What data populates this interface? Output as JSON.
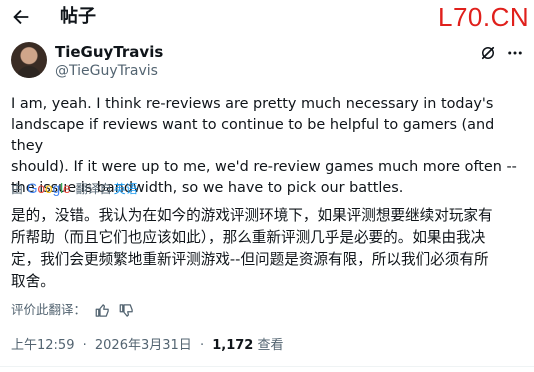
{
  "header": {
    "title": "帖子",
    "watermark": "L70.CN"
  },
  "author": {
    "display_name": "TieGuyTravis",
    "handle": "@TieGuyTravis"
  },
  "post": {
    "text": "I am, yeah. I think re-reviews are pretty much necessary in today's\nlandscape if reviews want to continue to be helpful to gamers (and they\nshould). If it were up to me, we'd re-review games much more often --\nthe issue is bandwidth, so we have to pick our battles.",
    "translated_by_prefix": "由",
    "translated_by_provider": "Google",
    "translated_by_suffix": "翻译自",
    "source_language": "英语",
    "translated_text": "是的，没错。我认为在如今的游戏评测环境下，如果评测想要继续对玩家有\n所帮助（而且它们也应该如此），那么重新评测几乎是必要的。如果由我决\n定，我们会更频繁地重新评测游戏--但问题是资源有限，所以我们必须有所\n取舍。",
    "rate_translation_label": "评价此翻译："
  },
  "meta": {
    "time": "上午12:59",
    "separator": "·",
    "date": "2026年3月31日",
    "views_count": "1,172",
    "views_label": "查看"
  },
  "colors": {
    "accent": "#1d9bf0",
    "secondary_text": "#536471",
    "watermark": "#e0201c"
  },
  "icons": {
    "back": "arrow-left-icon",
    "grok": "grok-icon",
    "more": "more-horizontal-icon",
    "thumbs_up": "thumbs-up-icon",
    "thumbs_down": "thumbs-down-icon"
  }
}
